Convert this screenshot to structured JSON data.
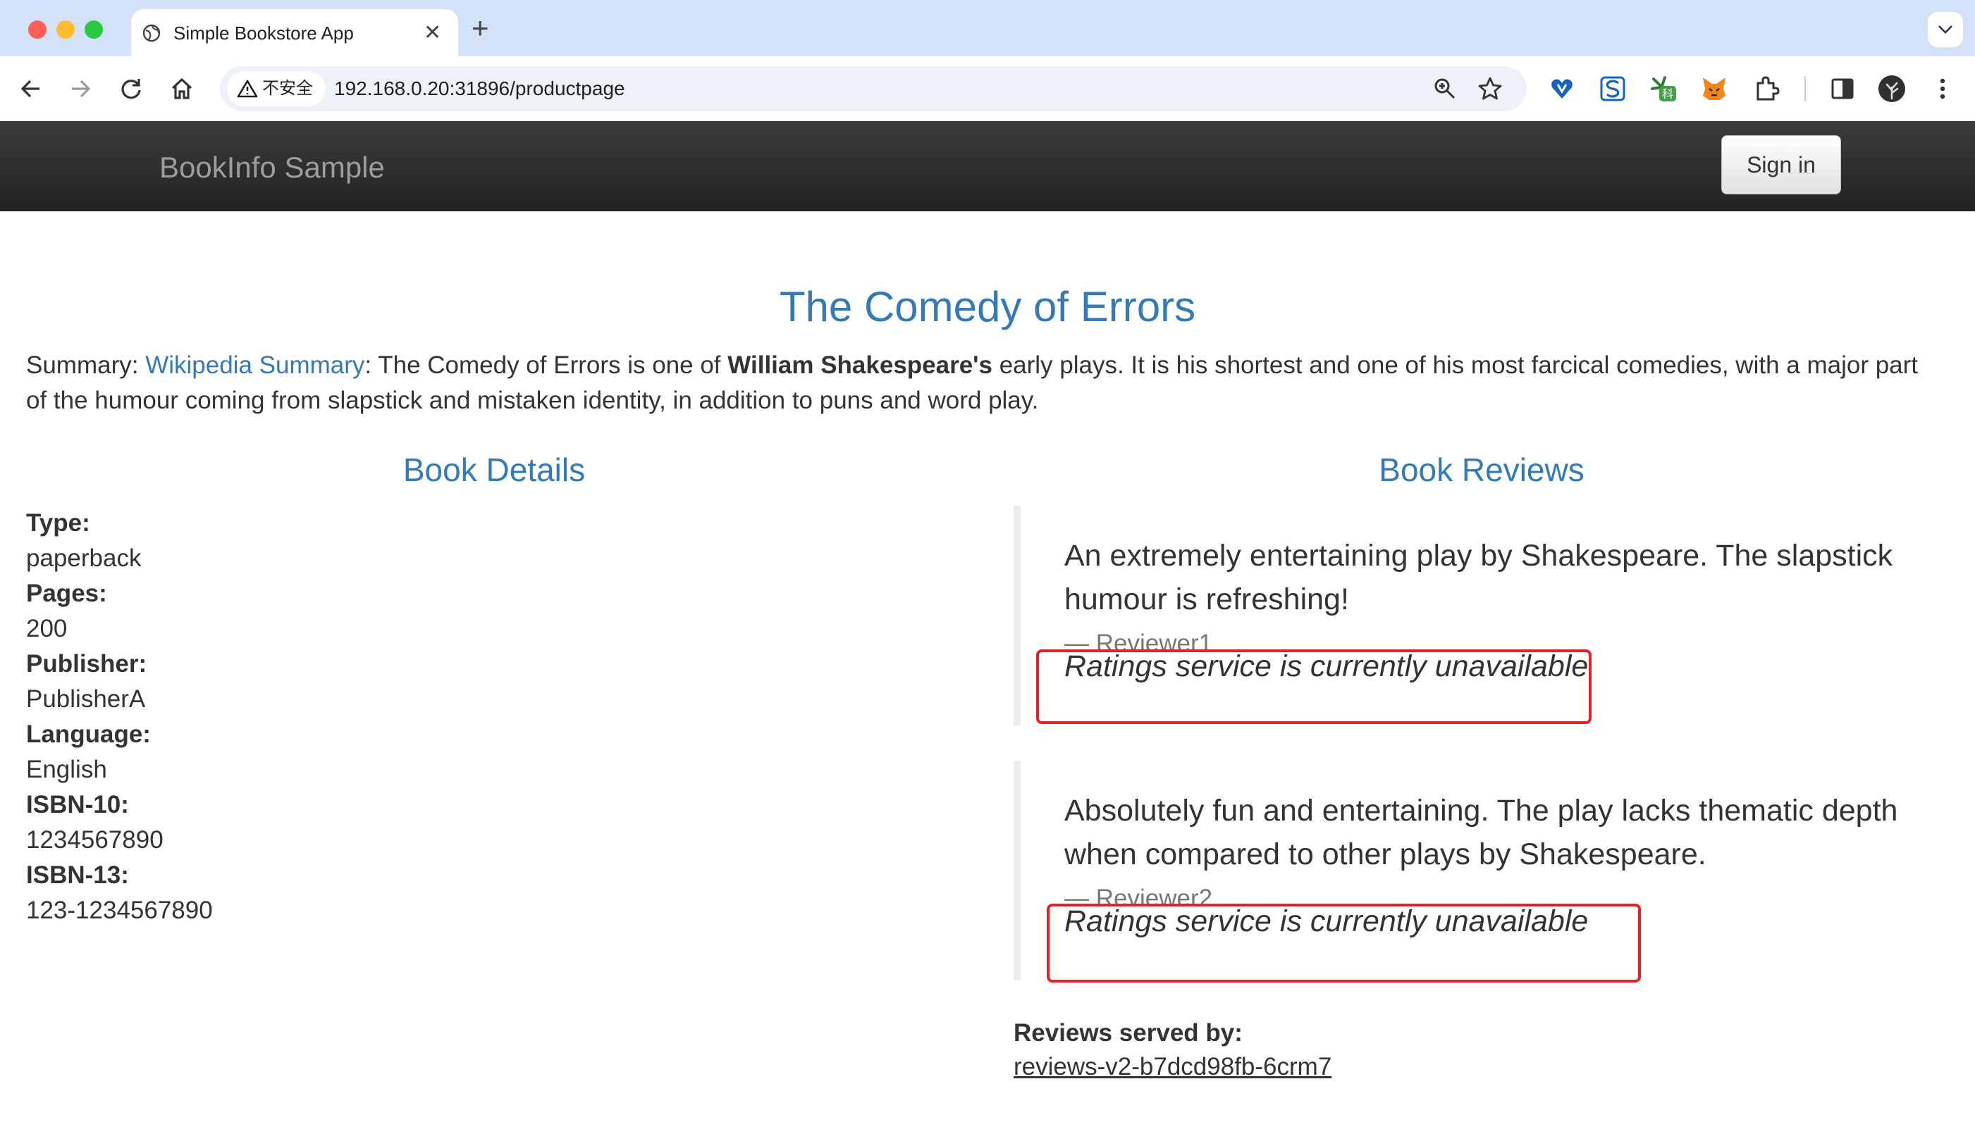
{
  "browser": {
    "tab": {
      "title": "Simple Bookstore App"
    },
    "security_label": "不安全",
    "url": "192.168.0.20:31896/productpage"
  },
  "app": {
    "brand": "BookInfo Sample",
    "sign_in_label": "Sign in"
  },
  "product": {
    "title": "The Comedy of Errors",
    "summary": {
      "prefix": "Summary: ",
      "link_text": "Wikipedia Summary",
      "text_before_bold": ": The Comedy of Errors is one of ",
      "bold": "William Shakespeare's",
      "text_after_bold": " early plays. It is his shortest and one of his most farcical comedies, with a major part of the humour coming from slapstick and mistaken identity, in addition to puns and word play."
    }
  },
  "details": {
    "heading": "Book Details",
    "fields": [
      {
        "label": "Type:",
        "value": "paperback"
      },
      {
        "label": "Pages:",
        "value": "200"
      },
      {
        "label": "Publisher:",
        "value": "PublisherA"
      },
      {
        "label": "Language:",
        "value": "English"
      },
      {
        "label": "ISBN-10:",
        "value": "1234567890"
      },
      {
        "label": "ISBN-13:",
        "value": "123-1234567890"
      }
    ]
  },
  "reviews": {
    "heading": "Book Reviews",
    "items": [
      {
        "text": "An extremely entertaining play by Shakespeare. The slapstick humour is refreshing!",
        "reviewer": "— Reviewer1",
        "rating_message": "Ratings service is currently unavailable"
      },
      {
        "text": "Absolutely fun and entertaining. The play lacks thematic depth when compared to other plays by Shakespeare.",
        "reviewer": "— Reviewer2",
        "rating_message": "Ratings service is currently unavailable"
      }
    ],
    "served_by_label": "Reviews served by:",
    "served_by_value": "reviews-v2-b7dcd98fb-6crm7"
  },
  "colors": {
    "link": "#337ab7",
    "navbar": "#222222",
    "highlight": "#e52222"
  }
}
